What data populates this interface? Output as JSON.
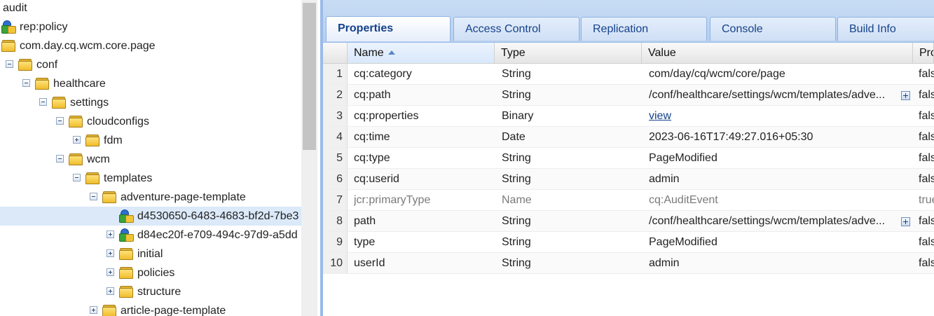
{
  "tree": {
    "items": [
      {
        "label": "audit",
        "icon": "none"
      },
      {
        "label": "rep:policy",
        "icon": "node-icon"
      },
      {
        "label": "com.day.cq.wcm.core.page",
        "icon": "folder-icon"
      },
      {
        "label": "conf",
        "icon": "folder-icon",
        "toggle": "minus"
      },
      {
        "label": "healthcare",
        "icon": "folder-icon",
        "toggle": "minus"
      },
      {
        "label": "settings",
        "icon": "folder-icon",
        "toggle": "minus"
      },
      {
        "label": "cloudconfigs",
        "icon": "folder-icon",
        "toggle": "minus"
      },
      {
        "label": "fdm",
        "icon": "folder-icon",
        "toggle": "plus"
      },
      {
        "label": "wcm",
        "icon": "folder-icon",
        "toggle": "minus"
      },
      {
        "label": "templates",
        "icon": "folder-icon",
        "toggle": "minus"
      },
      {
        "label": "adventure-page-template",
        "icon": "folder-icon",
        "toggle": "minus"
      },
      {
        "label": "d4530650-6483-4683-bf2d-7be3",
        "icon": "node-icon",
        "selected": true
      },
      {
        "label": "d84ec20f-e709-494c-97d9-a5dd",
        "icon": "node-icon",
        "toggle": "plus"
      },
      {
        "label": "initial",
        "icon": "folder-icon",
        "toggle": "plus"
      },
      {
        "label": "policies",
        "icon": "folder-icon",
        "toggle": "plus"
      },
      {
        "label": "structure",
        "icon": "folder-icon",
        "toggle": "plus"
      },
      {
        "label": "article-page-template",
        "icon": "folder-icon",
        "toggle": "plus"
      }
    ]
  },
  "tabs": [
    {
      "label": "Properties",
      "active": true
    },
    {
      "label": "Access Control"
    },
    {
      "label": "Replication"
    },
    {
      "label": "Console"
    },
    {
      "label": "Build Info"
    }
  ],
  "grid": {
    "headers": {
      "name": "Name",
      "type": "Type",
      "value": "Value",
      "protected": "Pro"
    },
    "rows": [
      {
        "num": "1",
        "name": "cq:category",
        "type": "String",
        "value": "com/day/cq/wcm/core/page",
        "pro": "fals"
      },
      {
        "num": "2",
        "name": "cq:path",
        "type": "String",
        "value": "/conf/healthcare/settings/wcm/templates/adve...",
        "pro": "fals",
        "expand": true
      },
      {
        "num": "3",
        "name": "cq:properties",
        "type": "Binary",
        "value": "view",
        "pro": "fals",
        "link": true
      },
      {
        "num": "4",
        "name": "cq:time",
        "type": "Date",
        "value": "2023-06-16T17:49:27.016+05:30",
        "pro": "fals"
      },
      {
        "num": "5",
        "name": "cq:type",
        "type": "String",
        "value": "PageModified",
        "pro": "fals"
      },
      {
        "num": "6",
        "name": "cq:userid",
        "type": "String",
        "value": "admin",
        "pro": "fals"
      },
      {
        "num": "7",
        "name": "jcr:primaryType",
        "type": "Name",
        "value": "cq:AuditEvent",
        "pro": "true",
        "dim": true
      },
      {
        "num": "8",
        "name": "path",
        "type": "String",
        "value": "/conf/healthcare/settings/wcm/templates/adve...",
        "pro": "fals",
        "expand": true
      },
      {
        "num": "9",
        "name": "type",
        "type": "String",
        "value": "PageModified",
        "pro": "fals"
      },
      {
        "num": "10",
        "name": "userId",
        "type": "String",
        "value": "admin",
        "pro": "fals"
      }
    ]
  }
}
